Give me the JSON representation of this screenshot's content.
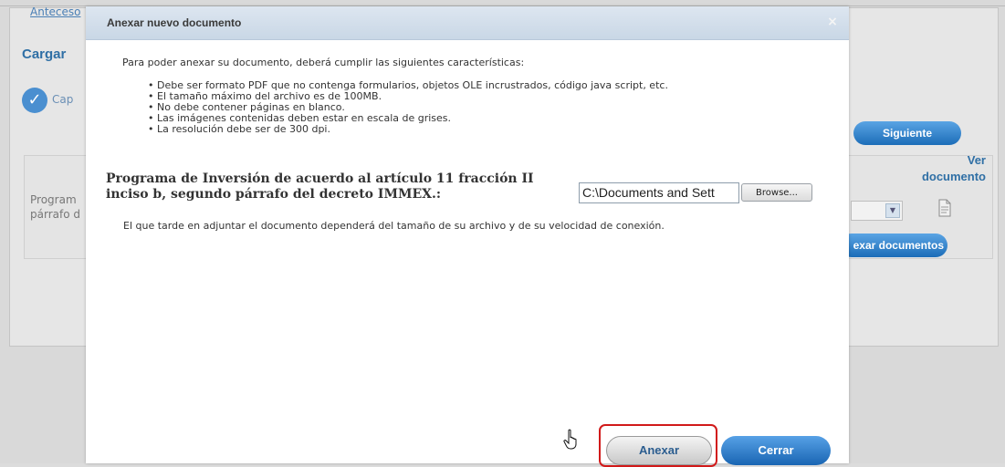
{
  "background": {
    "link_text": "Anteceso",
    "section_title": "Cargar",
    "step_label": "Cap",
    "row_text_line1": "Program",
    "row_text_line2": "párrafo d",
    "next_button": "Siguiente",
    "view_doc_line1": "Ver",
    "view_doc_line2": "documento",
    "attach_docs_button": "exar documentos"
  },
  "dialog": {
    "title": "Anexar nuevo documento",
    "close_glyph": "×",
    "intro": "Para poder anexar su documento, deberá cumplir las siguientes características:",
    "requirements": [
      "Debe ser formato PDF que no contenga formularios, objetos OLE incrustrados, código java script, etc.",
      "El tamaño máximo del archivo es de 100MB.",
      "No debe contener páginas en blanco.",
      "Las imágenes contenidas deben estar en escala de grises.",
      "La resolución debe ser de 300 dpi."
    ],
    "field_label_line1": "Programa de Inversión de acuerdo al artículo 11 fracción II",
    "field_label_line2": "inciso b, segundo párrafo del decreto IMMEX.:",
    "file_path": "C:\\Documents and Sett",
    "browse_label": "Browse...",
    "note": "El que tarde en adjuntar el documento dependerá del tamaño de su archivo y de su velocidad de conexión.",
    "attach_button": "Anexar",
    "close_button": "Cerrar"
  },
  "colors": {
    "accent": "#1c6db8",
    "highlight": "#d11a1a"
  },
  "icons": {
    "close": "close-icon",
    "check": "check-circle-icon",
    "document": "document-icon",
    "cursor": "hand-cursor-icon"
  }
}
